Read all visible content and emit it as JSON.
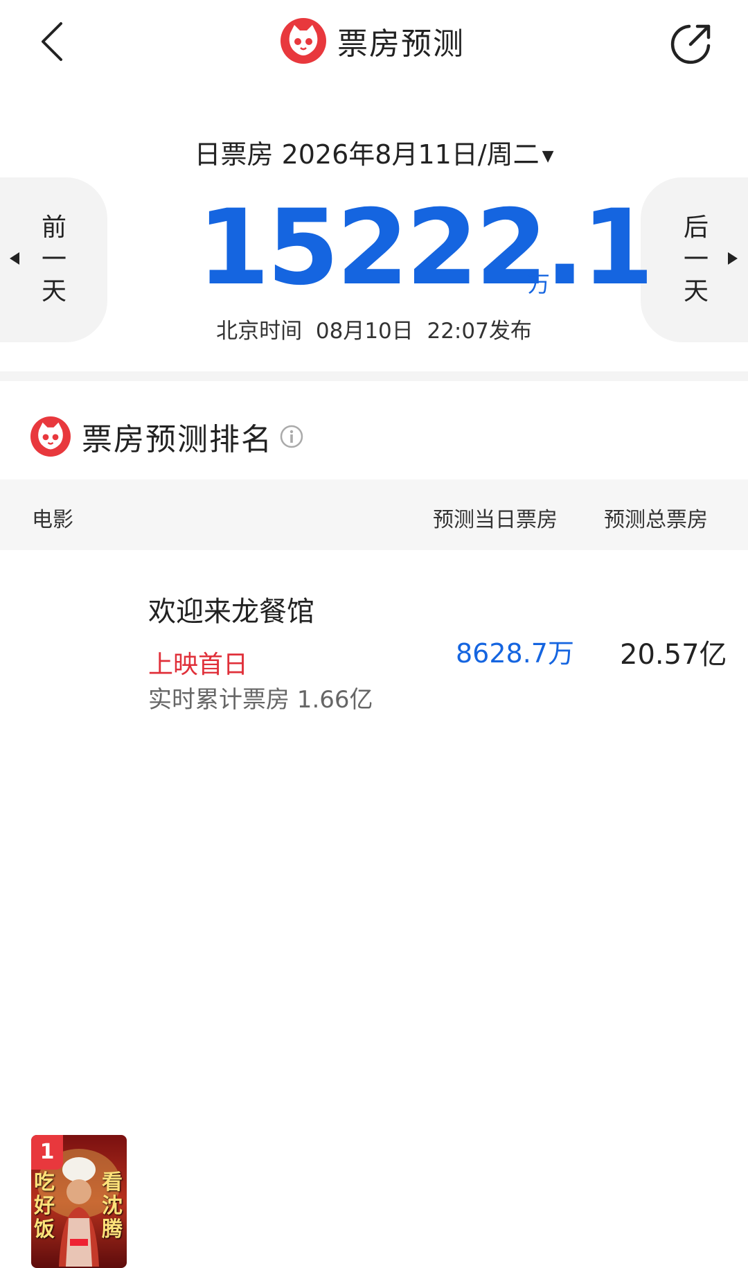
{
  "header": {
    "title": "票房预测",
    "back_icon": "back-arrow-icon",
    "share_icon": "share-icon",
    "logo_icon": "cat-logo-icon"
  },
  "summary": {
    "date_prefix": "日票房",
    "date": "2026年8月11日/周二",
    "dropdown_caret": "▼",
    "total_value": "15222.1",
    "total_unit": "万",
    "publish_text": "北京时间  08月10日  22:07发布",
    "prev_day": [
      "前",
      "一",
      "天"
    ],
    "next_day": [
      "后",
      "一",
      "天"
    ]
  },
  "ranking": {
    "title": "票房预测排名",
    "columns": {
      "movie": "电影",
      "day_forecast": "预测当日票房",
      "total_forecast": "预测总票房"
    },
    "rows": [
      {
        "rank": "1",
        "name": "欢迎来龙餐馆",
        "tag": "上映首日",
        "cumulative": "实时累计票房 1.66亿",
        "day_value": "8628.7万",
        "total_value": "20.57亿",
        "poster_text_left": "吃好饭",
        "poster_text_right": "看沈腾"
      }
    ]
  },
  "colors": {
    "accent_blue": "#1565e0",
    "brand_red": "#e8383d",
    "tag_red": "#e0303a"
  }
}
